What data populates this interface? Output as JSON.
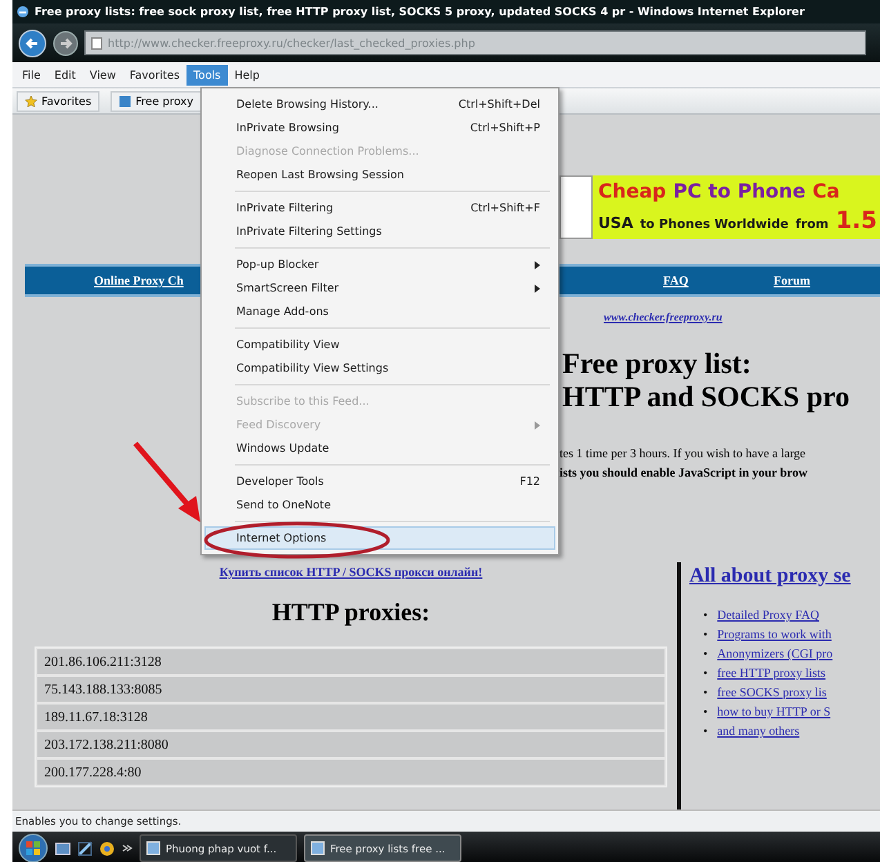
{
  "window": {
    "title": "Free proxy lists: free sock proxy list, free HTTP proxy list, SOCKS 5 proxy, updated SOCKS 4 pr - Windows Internet Explorer"
  },
  "address_bar": {
    "url": "http://www.checker.freeproxy.ru/checker/last_checked_proxies.php"
  },
  "menu_bar": [
    {
      "label": "File",
      "selected": false
    },
    {
      "label": "Edit",
      "selected": false
    },
    {
      "label": "View",
      "selected": false
    },
    {
      "label": "Favorites",
      "selected": false
    },
    {
      "label": "Tools",
      "selected": true
    },
    {
      "label": "Help",
      "selected": false
    }
  ],
  "favorites_bar": {
    "favorites": "Favorites",
    "tab": "Free proxy"
  },
  "tools_menu": [
    {
      "kind": "item",
      "label": "Delete Browsing History...",
      "shortcut": "Ctrl+Shift+Del",
      "disabled": false,
      "submenu": false,
      "selected": false
    },
    {
      "kind": "item",
      "label": "InPrivate Browsing",
      "shortcut": "Ctrl+Shift+P",
      "disabled": false,
      "submenu": false,
      "selected": false
    },
    {
      "kind": "item",
      "label": "Diagnose Connection Problems...",
      "disabled": true,
      "submenu": false,
      "selected": false
    },
    {
      "kind": "item",
      "label": "Reopen Last Browsing Session",
      "disabled": false,
      "submenu": false,
      "selected": false
    },
    {
      "kind": "separator"
    },
    {
      "kind": "item",
      "label": "InPrivate Filtering",
      "shortcut": "Ctrl+Shift+F",
      "disabled": false,
      "submenu": false,
      "selected": false
    },
    {
      "kind": "item",
      "label": "InPrivate Filtering Settings",
      "disabled": false,
      "submenu": false,
      "selected": false
    },
    {
      "kind": "separator"
    },
    {
      "kind": "item",
      "label": "Pop-up Blocker",
      "disabled": false,
      "submenu": true,
      "selected": false
    },
    {
      "kind": "item",
      "label": "SmartScreen Filter",
      "disabled": false,
      "submenu": true,
      "selected": false
    },
    {
      "kind": "item",
      "label": "Manage Add-ons",
      "disabled": false,
      "submenu": false,
      "selected": false
    },
    {
      "kind": "separator"
    },
    {
      "kind": "item",
      "label": "Compatibility View",
      "disabled": false,
      "submenu": false,
      "selected": false
    },
    {
      "kind": "item",
      "label": "Compatibility View Settings",
      "disabled": false,
      "submenu": false,
      "selected": false
    },
    {
      "kind": "separator"
    },
    {
      "kind": "item",
      "label": "Subscribe to this Feed...",
      "disabled": true,
      "submenu": false,
      "selected": false
    },
    {
      "kind": "item",
      "label": "Feed Discovery",
      "disabled": true,
      "submenu": true,
      "selected": false
    },
    {
      "kind": "item",
      "label": "Windows Update",
      "disabled": false,
      "submenu": false,
      "selected": false
    },
    {
      "kind": "separator"
    },
    {
      "kind": "item",
      "label": "Developer Tools",
      "shortcut": "F12",
      "disabled": false,
      "submenu": false,
      "selected": false
    },
    {
      "kind": "item",
      "label": "Send to OneNote",
      "disabled": false,
      "submenu": false,
      "selected": false
    },
    {
      "kind": "separator"
    },
    {
      "kind": "item",
      "label": "Internet Options",
      "disabled": false,
      "submenu": false,
      "selected": true
    }
  ],
  "page": {
    "banner": {
      "lines": [
        [
          {
            "text": "Cheap",
            "color": "#d8261c"
          },
          {
            "text": "PC to Phone",
            "color": "#7a1fa2"
          },
          {
            "text": "Ca",
            "color": "#d8261c"
          }
        ],
        [
          {
            "text": "USA",
            "color": "#1a1a1a"
          },
          {
            "text": "to Phones Worldwide",
            "color": "#1a1a1a"
          },
          {
            "text": "from",
            "color": "#1a1a1a"
          },
          {
            "text": "1.5",
            "color": "#d8261c"
          }
        ]
      ]
    },
    "nav": [
      "Online Proxy Ch",
      "FAQ",
      "Forum"
    ],
    "site_link": "www.checker.freeproxy.ru",
    "heading": [
      "Free proxy list:",
      "HTTP and SOCKS pro"
    ],
    "notice": [
      "tes 1 time per 3 hours. If you wish to have a large",
      "ists you should enable JavaScript in your brow"
    ],
    "buy_link": "Купить список HTTP / SOCKS прокси онлайн!",
    "proxies_heading": "HTTP proxies:",
    "proxies": [
      "201.86.106.211:3128",
      "75.143.188.133:8085",
      "189.11.67.18:3128",
      "203.172.138.211:8080",
      "200.177.228.4:80"
    ],
    "sidebar": {
      "heading": "All about proxy se",
      "marker": "•",
      "links": [
        "Detailed Proxy FAQ",
        "Programs to work with",
        "Anonymizers (CGI pro",
        "free HTTP proxy lists",
        "free SOCKS proxy lis",
        "how to buy HTTP or S",
        "and many others"
      ]
    }
  },
  "status_bar": {
    "text": "Enables you to change settings."
  },
  "taskbar": [
    {
      "label": "Phuong phap vuot f...",
      "selected": false
    },
    {
      "label": "Free proxy lists free ...",
      "selected": true
    }
  ]
}
